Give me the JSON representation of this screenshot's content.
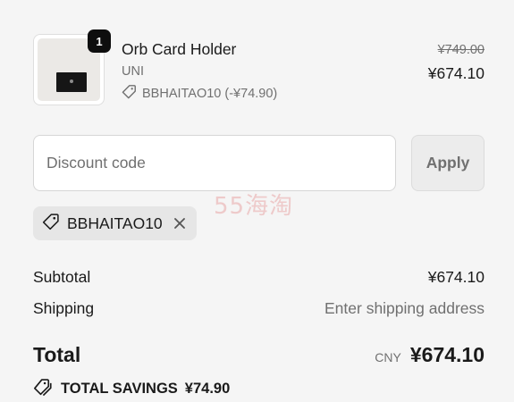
{
  "cart": {
    "item": {
      "quantity": "1",
      "title": "Orb Card Holder",
      "variant": "UNI",
      "discount_label": "BBHAITAO10 (-¥74.90)",
      "price_original": "¥749.00",
      "price_final": "¥674.10",
      "thumbnail_icon": "card-holder-image"
    }
  },
  "discount": {
    "placeholder": "Discount code",
    "value": "",
    "apply_label": "Apply",
    "applied_code": "BBHAITAO10"
  },
  "watermark": "55海淘",
  "summary": {
    "subtotal_label": "Subtotal",
    "subtotal_value": "¥674.10",
    "shipping_label": "Shipping",
    "shipping_value": "Enter shipping address",
    "total_label": "Total",
    "currency": "CNY",
    "total_value": "¥674.10",
    "savings_label": "TOTAL SAVINGS",
    "savings_value": "¥74.90"
  },
  "colors": {
    "background": "#f5f5f5",
    "text": "#1a1a1a",
    "muted": "#707070",
    "badge": "#0e0e0e"
  }
}
